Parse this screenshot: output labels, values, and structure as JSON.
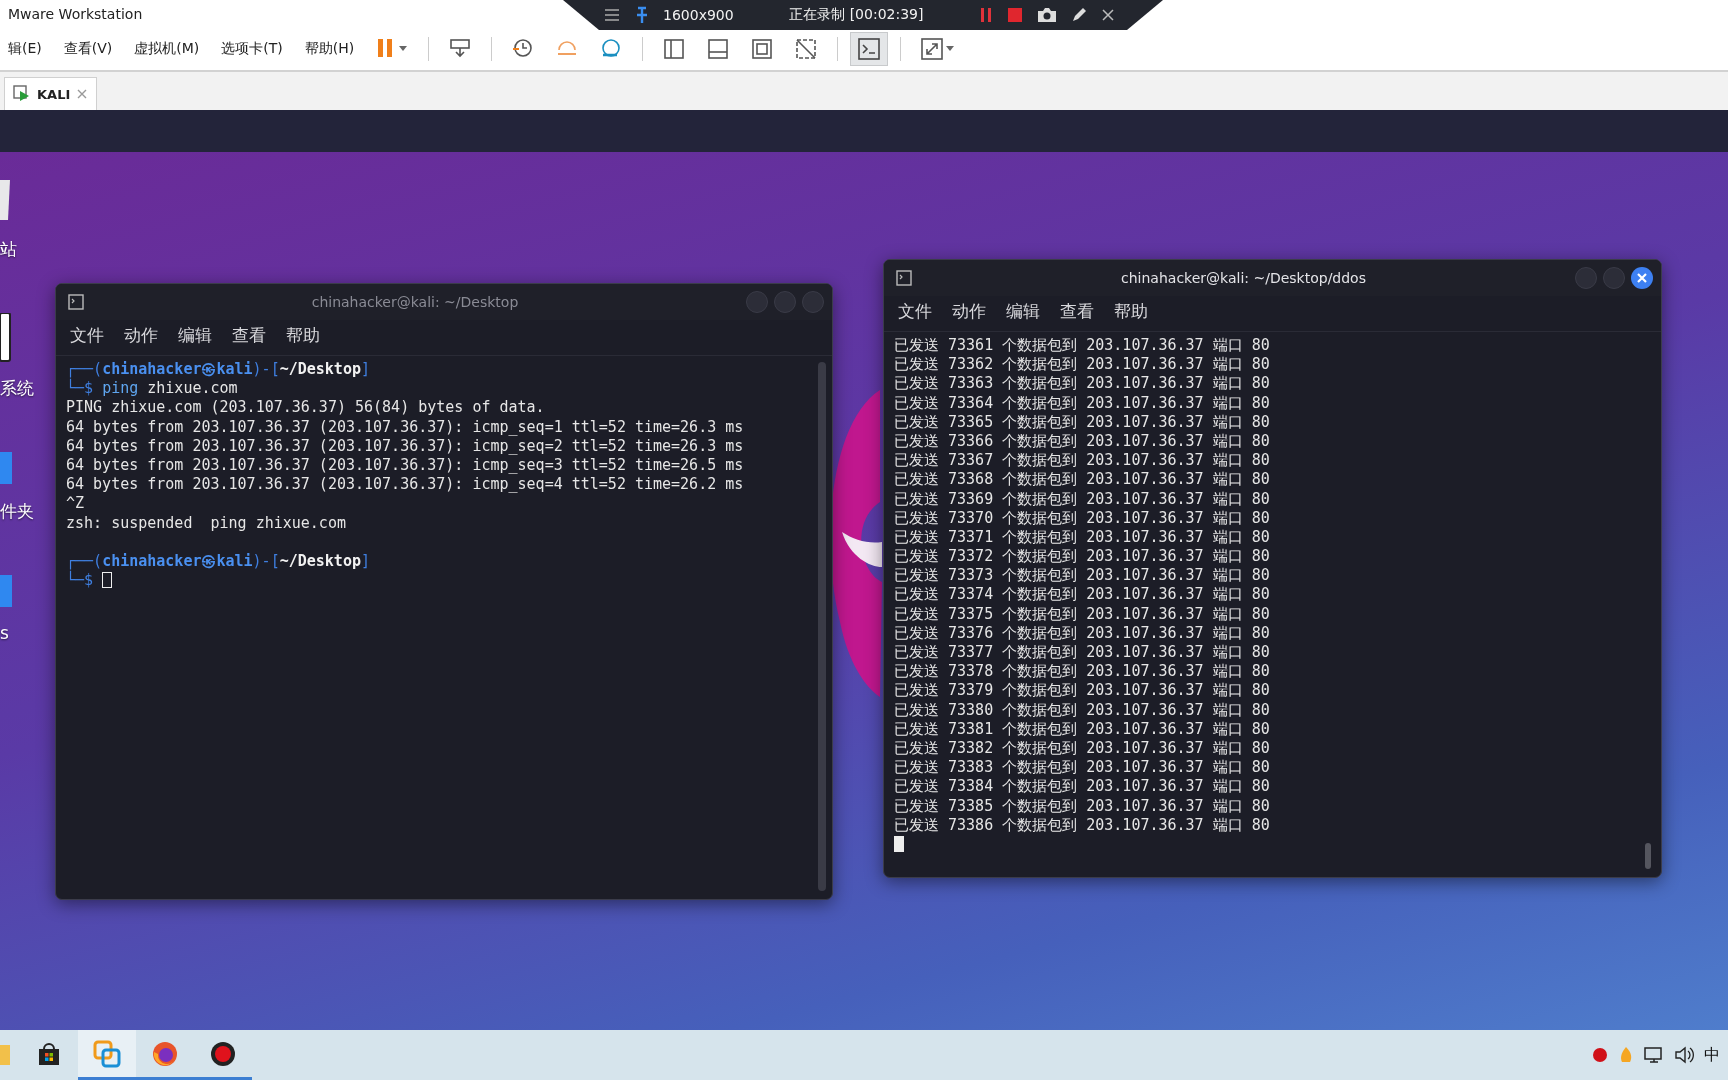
{
  "app": {
    "title": "Mware Workstation"
  },
  "recorder": {
    "resolution": "1600x900",
    "status": "正在录制 [00:02:39]"
  },
  "menu": [
    "辑(E)",
    "查看(V)",
    "虚拟机(M)",
    "选项卡(T)",
    "帮助(H)"
  ],
  "toolbar": [
    {
      "kind": "pause",
      "selected": false
    },
    {
      "kind": "separator"
    },
    {
      "kind": "send-keys",
      "selected": false
    },
    {
      "kind": "separator"
    },
    {
      "kind": "snapshot",
      "selected": false
    },
    {
      "kind": "revert",
      "selected": false
    },
    {
      "kind": "manager",
      "selected": false
    },
    {
      "kind": "separator"
    },
    {
      "kind": "library",
      "selected": false
    },
    {
      "kind": "thumbnail",
      "selected": false
    },
    {
      "kind": "fullscreen",
      "selected": false
    },
    {
      "kind": "unity",
      "selected": false
    },
    {
      "kind": "separator"
    },
    {
      "kind": "console",
      "selected": true
    },
    {
      "kind": "separator"
    },
    {
      "kind": "stretch",
      "selected": false
    }
  ],
  "tabs": [
    {
      "label": "KALI",
      "selected": true
    }
  ],
  "desktop_icons": [
    {
      "kind": "trash",
      "label": "站"
    },
    {
      "kind": "device",
      "label": "系统"
    },
    {
      "kind": "folder",
      "label": "件夹"
    },
    {
      "kind": "folder",
      "label": "s"
    }
  ],
  "windows": [
    {
      "title": "chinahacker@kali: ~/Desktop",
      "active": false,
      "menu": [
        "文件",
        "动作",
        "编辑",
        "查看",
        "帮助"
      ],
      "lines": [
        {
          "kind": "prompt",
          "open": "┌──(",
          "user": "chinahacker",
          "at": "㉿",
          "host": "kali",
          "mid": ")-[",
          "path": "~/Desktop",
          "close": "]"
        },
        {
          "kind": "command",
          "prefix": "└─$",
          "command": "ping",
          "args": "zhixue.com",
          "cursor": false
        },
        {
          "kind": "output",
          "text": "PING zhixue.com (203.107.36.37) 56(84) bytes of data."
        },
        {
          "kind": "output",
          "text": "64 bytes from 203.107.36.37 (203.107.36.37): icmp_seq=1 ttl=52 time=26.3 ms"
        },
        {
          "kind": "output",
          "text": "64 bytes from 203.107.36.37 (203.107.36.37): icmp_seq=2 ttl=52 time=26.3 ms"
        },
        {
          "kind": "output",
          "text": "64 bytes from 203.107.36.37 (203.107.36.37): icmp_seq=3 ttl=52 time=26.5 ms"
        },
        {
          "kind": "output",
          "text": "64 bytes from 203.107.36.37 (203.107.36.37): icmp_seq=4 ttl=52 time=26.2 ms"
        },
        {
          "kind": "output",
          "text": "^Z"
        },
        {
          "kind": "output",
          "text": "zsh: suspended  ping zhixue.com"
        },
        {
          "kind": "blank"
        },
        {
          "kind": "prompt",
          "open": "┌──(",
          "user": "chinahacker",
          "at": "㉿",
          "host": "kali",
          "mid": ")-[",
          "path": "~/Desktop",
          "close": "]"
        },
        {
          "kind": "command",
          "prefix": "└─$",
          "cursor": true
        }
      ]
    },
    {
      "title": "chinahacker@kali: ~/Desktop/ddos",
      "active": true,
      "menu": [
        "文件",
        "动作",
        "编辑",
        "查看",
        "帮助"
      ],
      "lines": [
        {
          "kind": "output",
          "text": "已发送 73361 个数据包到 203.107.36.37 端口 80"
        },
        {
          "kind": "output",
          "text": "已发送 73362 个数据包到 203.107.36.37 端口 80"
        },
        {
          "kind": "output",
          "text": "已发送 73363 个数据包到 203.107.36.37 端口 80"
        },
        {
          "kind": "output",
          "text": "已发送 73364 个数据包到 203.107.36.37 端口 80"
        },
        {
          "kind": "output",
          "text": "已发送 73365 个数据包到 203.107.36.37 端口 80"
        },
        {
          "kind": "output",
          "text": "已发送 73366 个数据包到 203.107.36.37 端口 80"
        },
        {
          "kind": "output",
          "text": "已发送 73367 个数据包到 203.107.36.37 端口 80"
        },
        {
          "kind": "output",
          "text": "已发送 73368 个数据包到 203.107.36.37 端口 80"
        },
        {
          "kind": "output",
          "text": "已发送 73369 个数据包到 203.107.36.37 端口 80"
        },
        {
          "kind": "output",
          "text": "已发送 73370 个数据包到 203.107.36.37 端口 80"
        },
        {
          "kind": "output",
          "text": "已发送 73371 个数据包到 203.107.36.37 端口 80"
        },
        {
          "kind": "output",
          "text": "已发送 73372 个数据包到 203.107.36.37 端口 80"
        },
        {
          "kind": "output",
          "text": "已发送 73373 个数据包到 203.107.36.37 端口 80"
        },
        {
          "kind": "output",
          "text": "已发送 73374 个数据包到 203.107.36.37 端口 80"
        },
        {
          "kind": "output",
          "text": "已发送 73375 个数据包到 203.107.36.37 端口 80"
        },
        {
          "kind": "output",
          "text": "已发送 73376 个数据包到 203.107.36.37 端口 80"
        },
        {
          "kind": "output",
          "text": "已发送 73377 个数据包到 203.107.36.37 端口 80"
        },
        {
          "kind": "output",
          "text": "已发送 73378 个数据包到 203.107.36.37 端口 80"
        },
        {
          "kind": "output",
          "text": "已发送 73379 个数据包到 203.107.36.37 端口 80"
        },
        {
          "kind": "output",
          "text": "已发送 73380 个数据包到 203.107.36.37 端口 80"
        },
        {
          "kind": "output",
          "text": "已发送 73381 个数据包到 203.107.36.37 端口 80"
        },
        {
          "kind": "output",
          "text": "已发送 73382 个数据包到 203.107.36.37 端口 80"
        },
        {
          "kind": "output",
          "text": "已发送 73383 个数据包到 203.107.36.37 端口 80"
        },
        {
          "kind": "output",
          "text": "已发送 73384 个数据包到 203.107.36.37 端口 80"
        },
        {
          "kind": "output",
          "text": "已发送 73385 个数据包到 203.107.36.37 端口 80"
        },
        {
          "kind": "output",
          "text": "已发送 73386 个数据包到 203.107.36.37 端口 80"
        },
        {
          "kind": "cursor"
        }
      ]
    }
  ],
  "taskbar": {
    "apps": [
      {
        "kind": "folder",
        "selected": false,
        "running": false
      },
      {
        "kind": "store",
        "selected": false,
        "running": false
      },
      {
        "kind": "vmware",
        "selected": true,
        "running": true
      },
      {
        "kind": "firefox",
        "selected": false,
        "running": true
      },
      {
        "kind": "recorder",
        "selected": false,
        "running": true
      }
    ],
    "ime": "中"
  }
}
